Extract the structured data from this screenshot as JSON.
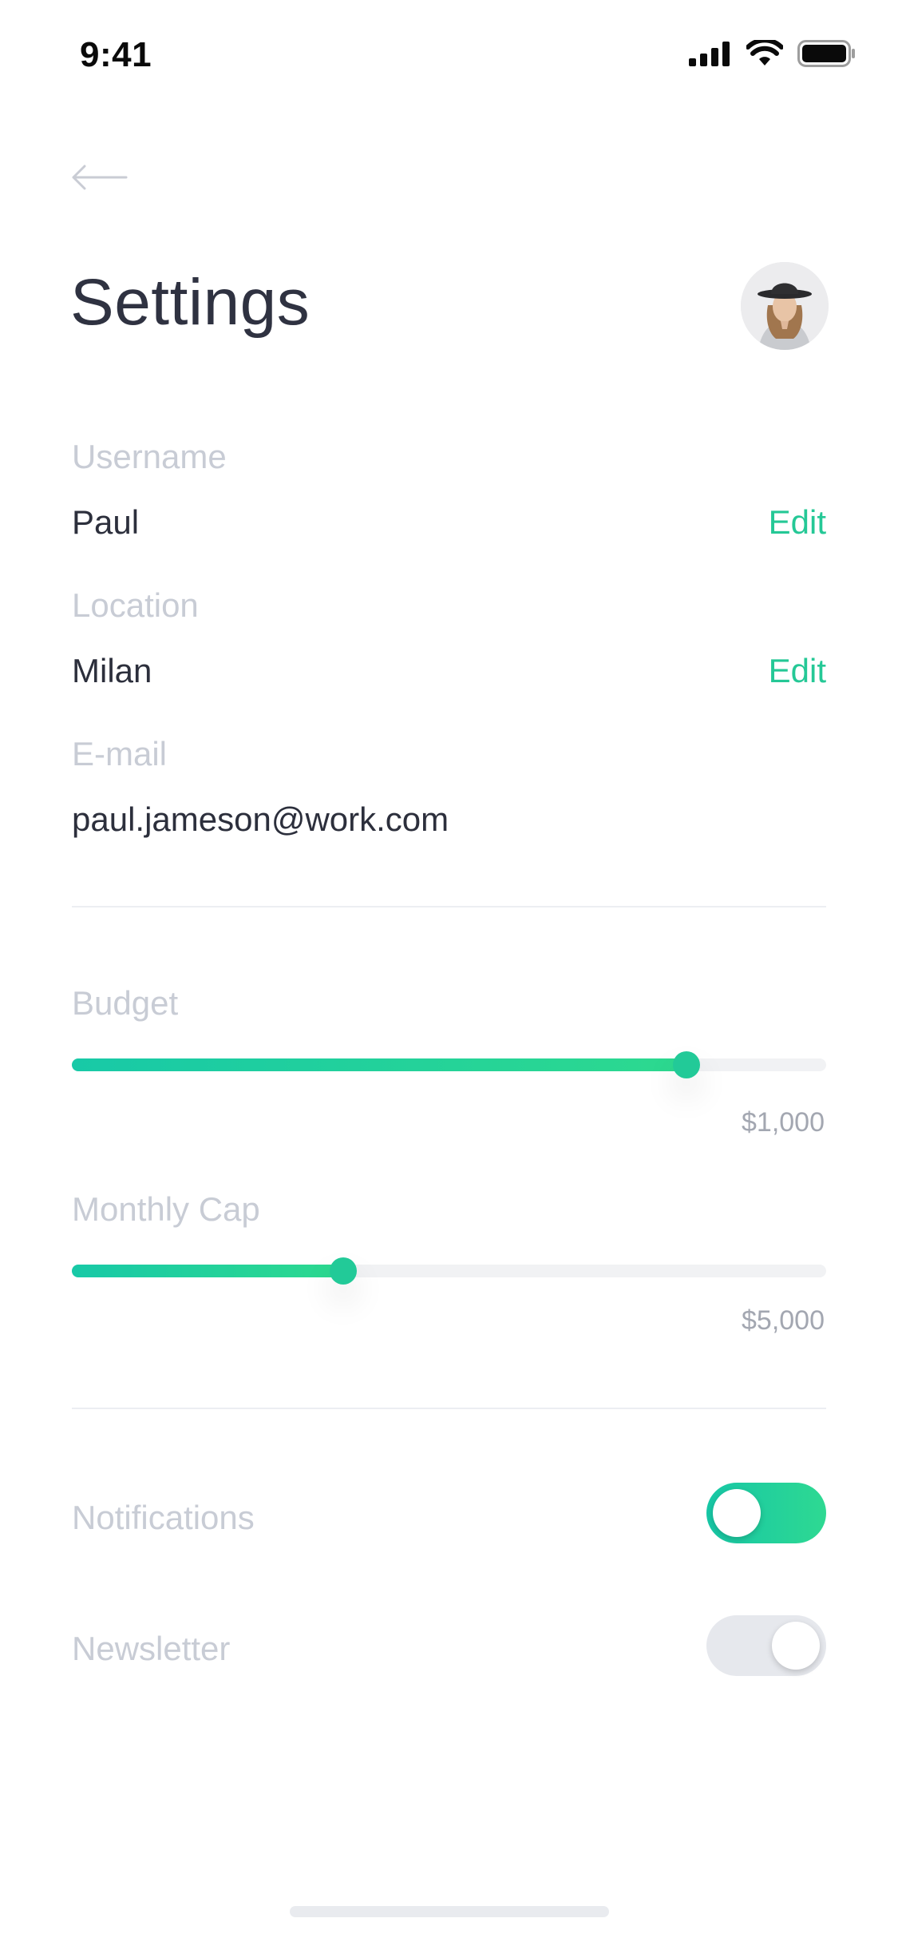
{
  "status_bar": {
    "time": "9:41"
  },
  "header": {
    "title": "Settings"
  },
  "fields": [
    {
      "label": "Username",
      "value": "Paul",
      "edit": "Edit"
    },
    {
      "label": "Location",
      "value": "Milan",
      "edit": "Edit"
    },
    {
      "label": "E-mail",
      "value": "paul.jameson@work.com"
    }
  ],
  "sliders": [
    {
      "label": "Budget",
      "value_text": "$1,000",
      "level_percent": 81.5
    },
    {
      "label": "Monthly Cap",
      "value_text": "$5,000",
      "level_percent": 36
    }
  ],
  "toggles": [
    {
      "label": "Notifications",
      "on": true
    },
    {
      "label": "Newsletter",
      "on": false
    }
  ],
  "colors": {
    "accent": "#25c896",
    "title": "#2f3241",
    "label": "#c8ccd5"
  },
  "icons": [
    "signal-icon",
    "wifi-icon",
    "battery-icon",
    "back-arrow-icon"
  ]
}
